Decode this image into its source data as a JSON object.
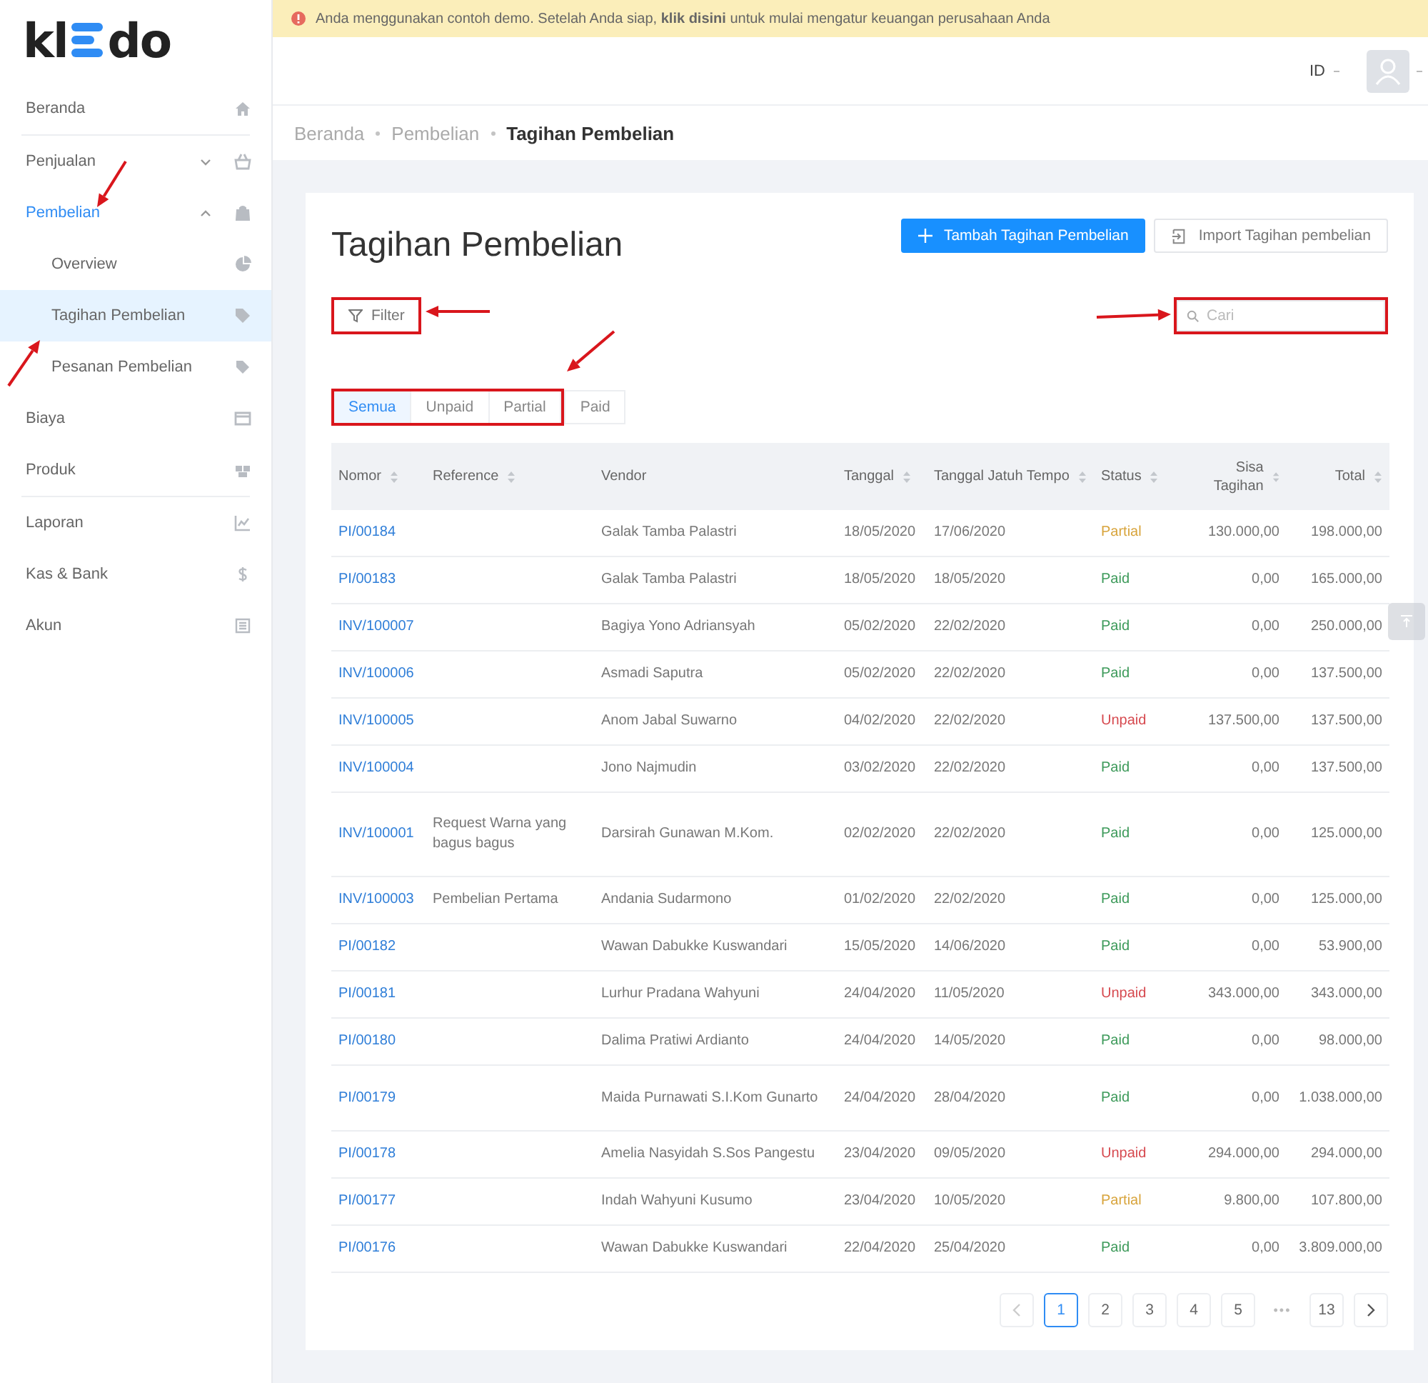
{
  "logo": {
    "left": "kl",
    "right": "do"
  },
  "banner": {
    "text": "Anda menggunakan contoh demo. Setelah Anda siap, **klik disini** untuk mulai mengatur keuangan perusahaan Anda"
  },
  "sidebar": {
    "items": [
      {
        "label": "Beranda",
        "kind": "link",
        "selected": false,
        "divider_after": true
      },
      {
        "label": "Penjualan",
        "kind": "group",
        "expanded": false,
        "selected": false,
        "divider_after": false
      },
      {
        "label": "Pembelian",
        "kind": "group",
        "expanded": true,
        "selected": true,
        "divider_after": false,
        "children": [
          {
            "label": "Overview",
            "selected": false
          },
          {
            "label": "Tagihan Pembelian",
            "selected": true
          },
          {
            "label": "Pesanan Pembelian",
            "selected": false
          }
        ]
      },
      {
        "label": "Biaya",
        "kind": "link",
        "selected": false,
        "divider_after": false
      },
      {
        "label": "Produk",
        "kind": "link",
        "selected": false,
        "divider_after": true
      },
      {
        "label": "Laporan",
        "kind": "link",
        "selected": false,
        "divider_after": false
      },
      {
        "label": "Kas & Bank",
        "kind": "link",
        "selected": false,
        "divider_after": false
      },
      {
        "label": "Akun",
        "kind": "link",
        "selected": false,
        "divider_after": false
      }
    ]
  },
  "header": {
    "language": "ID"
  },
  "breadcrumb": [
    "Beranda",
    "Pembelian",
    "Tagihan Pembelian"
  ],
  "page": {
    "title": "Tagihan Pembelian",
    "add_button": "Tambah Tagihan Pembelian",
    "import_button": "Import Tagihan pembelian",
    "filter_button": "Filter",
    "search": {
      "placeholder": "Cari"
    }
  },
  "status_tabs": [
    {
      "label": "Semua",
      "selected": true,
      "highlighted": true
    },
    {
      "label": "Unpaid",
      "selected": false,
      "highlighted": true
    },
    {
      "label": "Partial",
      "selected": false,
      "highlighted": true
    },
    {
      "label": "Paid",
      "selected": false,
      "highlighted": false
    }
  ],
  "table": {
    "columns": [
      {
        "label": "Nomor",
        "sortable": true
      },
      {
        "label": "Reference",
        "sortable": true
      },
      {
        "label": "Vendor",
        "sortable": false
      },
      {
        "label": "Tanggal",
        "sortable": true
      },
      {
        "label": "Tanggal Jatuh Tempo",
        "sortable": true
      },
      {
        "label": "Status",
        "sortable": true
      },
      {
        "label": "Sisa Tagihan",
        "sortable": true
      },
      {
        "label": "Total",
        "sortable": true
      }
    ],
    "rows": [
      {
        "nomor": "PI/00184",
        "reference": "",
        "vendor": "Galak Tamba Palastri",
        "tanggal": "18/05/2020",
        "jatuh_tempo": "17/06/2020",
        "status": {
          "label": "Partial",
          "kind": "partial"
        },
        "sisa": "130.000,00",
        "total": "198.000,00"
      },
      {
        "nomor": "PI/00183",
        "reference": "",
        "vendor": "Galak Tamba Palastri",
        "tanggal": "18/05/2020",
        "jatuh_tempo": "18/05/2020",
        "status": {
          "label": "Paid",
          "kind": "paid"
        },
        "sisa": "0,00",
        "total": "165.000,00"
      },
      {
        "nomor": "INV/100007",
        "reference": "",
        "vendor": "Bagiya Yono Adriansyah",
        "tanggal": "05/02/2020",
        "jatuh_tempo": "22/02/2020",
        "status": {
          "label": "Paid",
          "kind": "paid"
        },
        "sisa": "0,00",
        "total": "250.000,00"
      },
      {
        "nomor": "INV/100006",
        "reference": "",
        "vendor": "Asmadi Saputra",
        "tanggal": "05/02/2020",
        "jatuh_tempo": "22/02/2020",
        "status": {
          "label": "Paid",
          "kind": "paid"
        },
        "sisa": "0,00",
        "total": "137.500,00"
      },
      {
        "nomor": "INV/100005",
        "reference": "",
        "vendor": "Anom Jabal Suwarno",
        "tanggal": "04/02/2020",
        "jatuh_tempo": "22/02/2020",
        "status": {
          "label": "Unpaid",
          "kind": "unpaid"
        },
        "sisa": "137.500,00",
        "total": "137.500,00"
      },
      {
        "nomor": "INV/100004",
        "reference": "",
        "vendor": "Jono Najmudin",
        "tanggal": "03/02/2020",
        "jatuh_tempo": "22/02/2020",
        "status": {
          "label": "Paid",
          "kind": "paid"
        },
        "sisa": "0,00",
        "total": "137.500,00"
      },
      {
        "nomor": "INV/100001",
        "reference": "Request Warna yang bagus bagus",
        "vendor": "Darsirah Gunawan M.Kom.",
        "tanggal": "02/02/2020",
        "jatuh_tempo": "22/02/2020",
        "status": {
          "label": "Paid",
          "kind": "paid"
        },
        "sisa": "0,00",
        "total": "125.000,00"
      },
      {
        "nomor": "INV/100003",
        "reference": "Pembelian Pertama",
        "vendor": "Andania Sudarmono",
        "tanggal": "01/02/2020",
        "jatuh_tempo": "22/02/2020",
        "status": {
          "label": "Paid",
          "kind": "paid"
        },
        "sisa": "0,00",
        "total": "125.000,00"
      },
      {
        "nomor": "PI/00182",
        "reference": "",
        "vendor": "Wawan Dabukke Kuswandari",
        "tanggal": "15/05/2020",
        "jatuh_tempo": "14/06/2020",
        "status": {
          "label": "Paid",
          "kind": "paid"
        },
        "sisa": "0,00",
        "total": "53.900,00"
      },
      {
        "nomor": "PI/00181",
        "reference": "",
        "vendor": "Lurhur Pradana Wahyuni",
        "tanggal": "24/04/2020",
        "jatuh_tempo": "11/05/2020",
        "status": {
          "label": "Unpaid",
          "kind": "unpaid"
        },
        "sisa": "343.000,00",
        "total": "343.000,00"
      },
      {
        "nomor": "PI/00180",
        "reference": "",
        "vendor": "Dalima Pratiwi Ardianto",
        "tanggal": "24/04/2020",
        "jatuh_tempo": "14/05/2020",
        "status": {
          "label": "Paid",
          "kind": "paid"
        },
        "sisa": "0,00",
        "total": "98.000,00"
      },
      {
        "nomor": "PI/00179",
        "reference": "",
        "vendor": "Maida Purnawati S.I.Kom Gunarto",
        "tanggal": "24/04/2020",
        "jatuh_tempo": "28/04/2020",
        "status": {
          "label": "Paid",
          "kind": "paid"
        },
        "sisa": "0,00",
        "total": "1.038.000,00"
      },
      {
        "nomor": "PI/00178",
        "reference": "",
        "vendor": "Amelia Nasyidah S.Sos Pangestu",
        "tanggal": "23/04/2020",
        "jatuh_tempo": "09/05/2020",
        "status": {
          "label": "Unpaid",
          "kind": "unpaid"
        },
        "sisa": "294.000,00",
        "total": "294.000,00"
      },
      {
        "nomor": "PI/00177",
        "reference": "",
        "vendor": "Indah Wahyuni Kusumo",
        "tanggal": "23/04/2020",
        "jatuh_tempo": "10/05/2020",
        "status": {
          "label": "Partial",
          "kind": "partial"
        },
        "sisa": "9.800,00",
        "total": "107.800,00"
      },
      {
        "nomor": "PI/00176",
        "reference": "",
        "vendor": "Wawan Dabukke Kuswandari",
        "tanggal": "22/04/2020",
        "jatuh_tempo": "25/04/2020",
        "status": {
          "label": "Paid",
          "kind": "paid"
        },
        "sisa": "0,00",
        "total": "3.809.000,00"
      }
    ]
  },
  "pagination": {
    "pages": [
      {
        "label": "1",
        "kind": "page",
        "selected": true
      },
      {
        "label": "2",
        "kind": "page",
        "selected": false
      },
      {
        "label": "3",
        "kind": "page",
        "selected": false
      },
      {
        "label": "4",
        "kind": "page",
        "selected": false
      },
      {
        "label": "5",
        "kind": "page",
        "selected": false
      },
      {
        "label": "•••",
        "kind": "ellipsis",
        "selected": false
      },
      {
        "label": "13",
        "kind": "page",
        "selected": false
      }
    ]
  }
}
